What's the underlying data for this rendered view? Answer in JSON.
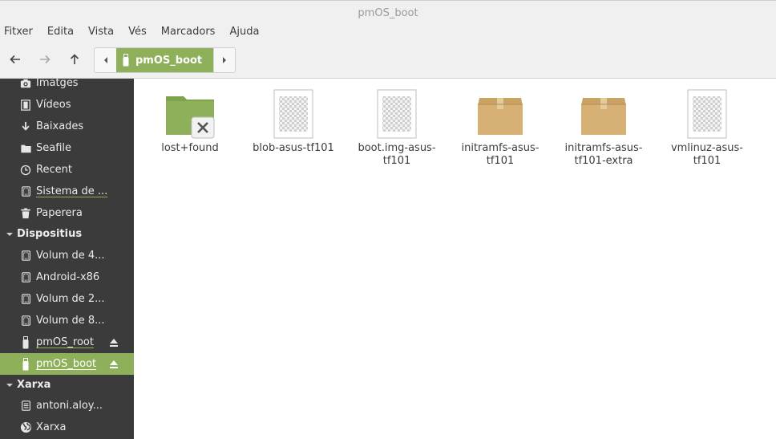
{
  "window": {
    "title": "pmOS_boot"
  },
  "menubar": {
    "items": [
      "Fitxer",
      "Edita",
      "Vista",
      "Vés",
      "Marcadors",
      "Ajuda"
    ]
  },
  "toolbar": {
    "back_icon": "arrow-left-icon",
    "forward_icon": "arrow-right-icon",
    "up_icon": "arrow-up-icon",
    "path": {
      "current": "pmOS_boot",
      "icon": "usb-drive-icon"
    }
  },
  "sidebar": {
    "places": [
      {
        "label": "Imatges",
        "icon": "camera-icon"
      },
      {
        "label": "Vídeos",
        "icon": "film-icon"
      },
      {
        "label": "Baixades",
        "icon": "download-icon"
      },
      {
        "label": "Seafile",
        "icon": "folder-icon"
      },
      {
        "label": "Recent",
        "icon": "clock-icon"
      },
      {
        "label": "Sistema de ...",
        "icon": "drive-icon"
      },
      {
        "label": "Paperera",
        "icon": "trash-icon"
      }
    ],
    "devices_header": "Dispositius",
    "devices": [
      {
        "label": "Volum de 4...",
        "icon": "drive-icon"
      },
      {
        "label": "Android-x86",
        "icon": "drive-icon"
      },
      {
        "label": "Volum de 2...",
        "icon": "drive-icon"
      },
      {
        "label": "Volum de 8...",
        "icon": "drive-icon"
      },
      {
        "label": "pmOS_root",
        "icon": "usb-drive-icon",
        "eject": true
      },
      {
        "label": "pmOS_boot",
        "icon": "usb-drive-icon",
        "eject": true,
        "selected": true
      }
    ],
    "network_header": "Xarxa",
    "network": [
      {
        "label": "antoni.aloy...",
        "icon": "server-icon"
      },
      {
        "label": "Xarxa",
        "icon": "globe-icon"
      }
    ]
  },
  "files": [
    {
      "name": "lost+found",
      "type": "folder-locked"
    },
    {
      "name": "blob-asus-tf101",
      "type": "generic"
    },
    {
      "name": "boot.img-asus-tf101",
      "type": "generic"
    },
    {
      "name": "initramfs-asus-tf101",
      "type": "archive"
    },
    {
      "name": "initramfs-asus-tf101-extra",
      "type": "archive"
    },
    {
      "name": "vmlinuz-asus-tf101",
      "type": "generic"
    }
  ],
  "colors": {
    "accent": "#8fb05a",
    "sidebar_bg": "#3b3b3b",
    "chrome_bg": "#f0f0f0"
  }
}
